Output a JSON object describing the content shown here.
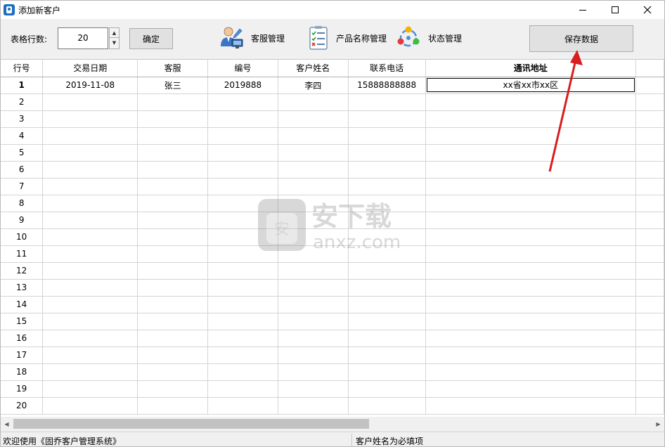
{
  "window": {
    "title": "添加新客户"
  },
  "toolbar": {
    "rows_label": "表格行数:",
    "rows_value": "20",
    "confirm_label": "确定",
    "customer_service_label": "客服管理",
    "product_names_label": "产品名称管理",
    "status_label": "状态管理",
    "save_label": "保存数据"
  },
  "grid": {
    "columns": [
      "行号",
      "交易日期",
      "客服",
      "编号",
      "客户姓名",
      "联系电话",
      "通讯地址"
    ],
    "row1": {
      "row_no": "1",
      "date": "2019-11-08",
      "service": "张三",
      "code": "2019888",
      "customer": "李四",
      "phone": "15888888888",
      "address": "xx省xx市xx区"
    },
    "row_numbers": [
      "2",
      "3",
      "4",
      "5",
      "6",
      "7",
      "8",
      "9",
      "10",
      "11",
      "12",
      "13",
      "14",
      "15",
      "16",
      "17",
      "18",
      "19",
      "20"
    ]
  },
  "statusbar": {
    "left": "欢迎使用《固乔客户管理系统》",
    "right": "客户姓名为必填项"
  },
  "watermark": {
    "brand": "安下载",
    "domain": "anxz.com"
  },
  "colors": {
    "arrow": "#d81e1e",
    "grid_line": "#d4d4d4"
  }
}
